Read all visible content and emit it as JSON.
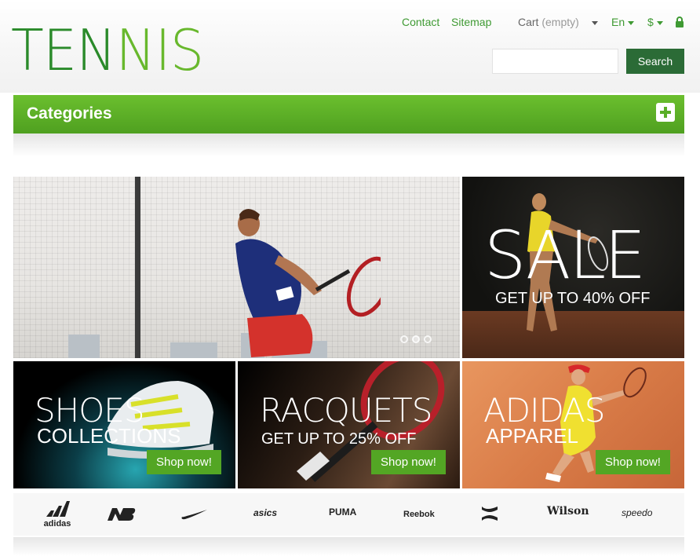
{
  "header": {
    "logo_part1": "TEN",
    "logo_part2": "NIS",
    "links": {
      "contact": "Contact",
      "sitemap": "Sitemap",
      "cart_label": "Cart",
      "cart_status": "(empty)",
      "language": "En",
      "currency": "$"
    },
    "search": {
      "placeholder": "",
      "button_label": "Search"
    }
  },
  "categories": {
    "title": "Categories"
  },
  "banners": {
    "sale": {
      "title": "SALE",
      "subtitle": "GET UP TO 40% OFF"
    },
    "shoes": {
      "line1": "SHOES",
      "line2": "COLLECTIONS",
      "cta": "Shop now!"
    },
    "racquets": {
      "line1": "RACQUETS",
      "line2": "GET UP TO 25% OFF",
      "cta": "Shop now!"
    },
    "adidas": {
      "line1": "ADIDAS",
      "line2": "APPAREL",
      "cta": "Shop now!"
    }
  },
  "brands": [
    "adidas",
    "New Balance",
    "Nike",
    "asics",
    "PUMA",
    "Reebok",
    "Under Armour",
    "Wilson",
    "speedo"
  ],
  "colors": {
    "green": "#53a624",
    "dark_green": "#2b6b36",
    "link_green": "#3f9a33"
  }
}
